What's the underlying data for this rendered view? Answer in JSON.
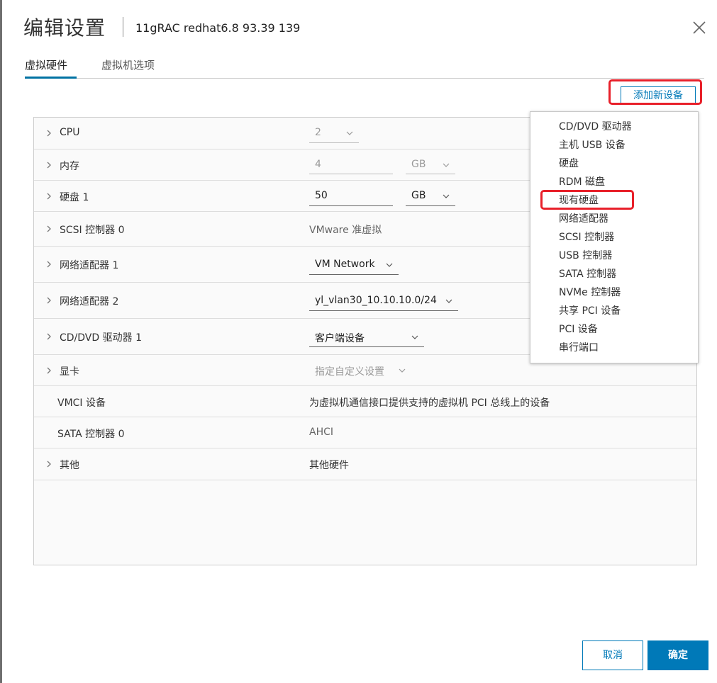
{
  "dialog": {
    "title": "编辑设置",
    "subtitle": "11gRAC redhat6.8 93.39 139",
    "close_icon": "close-icon"
  },
  "tabs": [
    {
      "label": "虚拟硬件",
      "active": true
    },
    {
      "label": "虚拟机选项",
      "active": false
    }
  ],
  "add_device_button": "添加新设备",
  "hardware": {
    "cpu": {
      "label": "CPU",
      "value": "2"
    },
    "memory": {
      "label": "内存",
      "value": "4",
      "unit": "GB"
    },
    "disk1": {
      "label": "硬盘 1",
      "value": "50",
      "unit": "GB"
    },
    "scsi0": {
      "label": "SCSI 控制器 0",
      "value": "VMware 准虚拟"
    },
    "nic1": {
      "label": "网络适配器 1",
      "value": "VM Network"
    },
    "nic2": {
      "label": "网络适配器 2",
      "value": "yl_vlan30_10.10.10.0/24"
    },
    "cddvd1": {
      "label": "CD/DVD 驱动器 1",
      "value": "客户端设备"
    },
    "video": {
      "label": "显卡",
      "value": "指定自定义设置"
    },
    "vmci": {
      "label": "VMCI 设备",
      "value": "为虚拟机通信接口提供支持的虚拟机 PCI 总线上的设备"
    },
    "sata0": {
      "label": "SATA 控制器 0",
      "value": "AHCI"
    },
    "other": {
      "label": "其他",
      "value": "其他硬件"
    }
  },
  "add_menu": [
    "CD/DVD 驱动器",
    "主机 USB 设备",
    "硬盘",
    "RDM 磁盘",
    "现有硬盘",
    "网络适配器",
    "SCSI 控制器",
    "USB 控制器",
    "SATA 控制器",
    "NVMe 控制器",
    "共享 PCI 设备",
    "PCI 设备",
    "串行端口"
  ],
  "footer": {
    "cancel": "取消",
    "ok": "确定"
  },
  "colors": {
    "accent": "#0079b8",
    "highlight": "#e8202a"
  }
}
